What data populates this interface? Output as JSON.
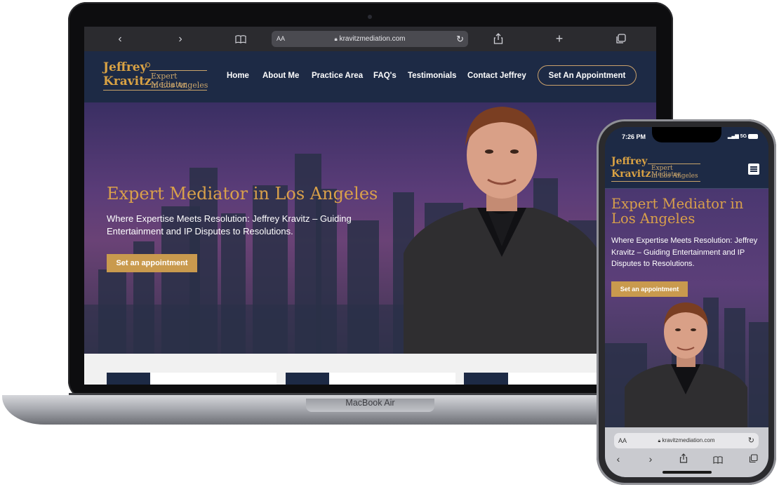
{
  "laptop": {
    "browser": {
      "back_icon": "chevron-left-icon",
      "forward_icon": "chevron-right-icon",
      "bookmarks_icon": "book-icon",
      "text_size_label": "AA",
      "url": "kravitzmediation.com",
      "reload_icon": "reload-icon",
      "share_icon": "share-icon",
      "new_tab_icon": "plus-icon",
      "tabs_icon": "tabs-icon"
    },
    "logo": {
      "first_name": "Jeffrey",
      "last_name": "Kravitz",
      "tagline_line1": "Expert Mediator",
      "tagline_line2": "in Los Angeles"
    },
    "nav": {
      "items": [
        "Home",
        "About Me",
        "Practice Area",
        "FAQ's",
        "Testimonials",
        "Contact Jeffrey"
      ],
      "cta": "Set An Appointment"
    },
    "hero": {
      "title": "Expert Mediator in Los Angeles",
      "subtitle": "Where Expertise Meets Resolution: Jeffrey Kravitz – Guiding Entertainment and IP Disputes to Resolutions.",
      "button": "Set an appointment"
    },
    "device_label": "MacBook Air"
  },
  "phone": {
    "status": {
      "time": "7:26 PM",
      "signal": "5G"
    },
    "logo": {
      "first_name": "Jeffrey",
      "last_name": "Kravitz",
      "tagline_line1": "Expert Mediator",
      "tagline_line2": "in Los Angeles"
    },
    "menu_icon": "hamburger-menu-icon",
    "hero": {
      "title": "Expert Mediator in Los Angeles",
      "subtitle": "Where Expertise Meets Resolution: Jeffrey Kravitz – Guiding Entertainment and IP Disputes to Resolutions.",
      "button": "Set an appointment"
    },
    "browser": {
      "text_size_label": "AA",
      "url": "kravitzmediation.com",
      "reload_icon": "reload-icon",
      "back_icon": "chevron-left-icon",
      "forward_icon": "chevron-right-icon",
      "share_icon": "share-icon",
      "bookmarks_icon": "book-icon",
      "tabs_icon": "tabs-icon"
    }
  },
  "colors": {
    "navy": "#1d2a45",
    "gold": "#d9a04a",
    "button_gold": "#c99a4e",
    "hero_purple": "#5a3c78"
  }
}
